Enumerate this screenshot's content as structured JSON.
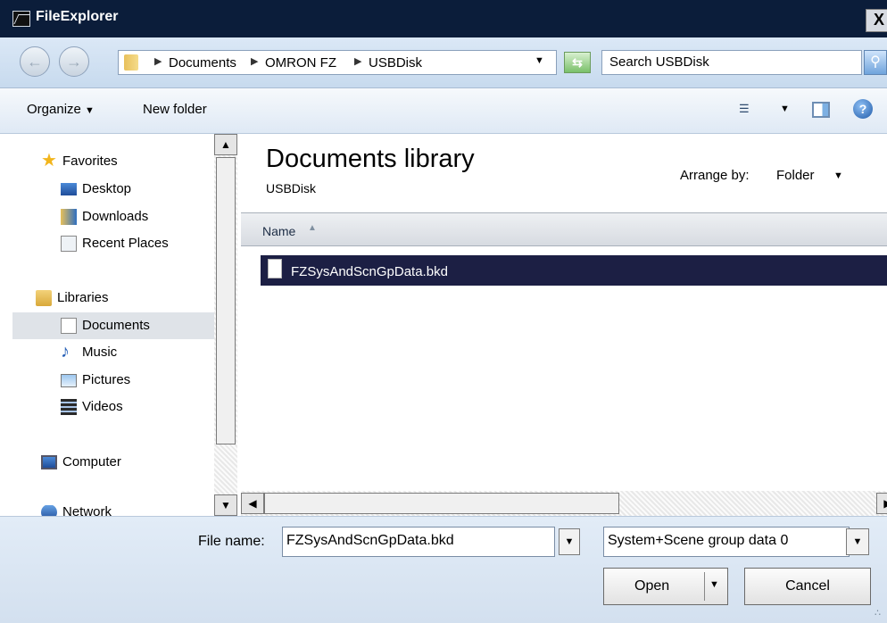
{
  "window": {
    "title": "FileExplorer",
    "close_label": "X"
  },
  "nav": {
    "back_icon": "back-arrow-icon",
    "forward_icon": "forward-arrow-icon",
    "breadcrumbs": [
      "Documents",
      "OMRON FZ",
      "USBDisk"
    ],
    "search_placeholder": "Search USBDisk"
  },
  "toolbar": {
    "organize_label": "Organize",
    "new_folder_label": "New folder"
  },
  "sidebar": {
    "favorites": {
      "label": "Favorites",
      "items": [
        "Desktop",
        "Downloads",
        "Recent Places"
      ]
    },
    "libraries": {
      "label": "Libraries",
      "items": [
        "Documents",
        "Music",
        "Pictures",
        "Videos"
      ]
    },
    "computer": {
      "label": "Computer"
    },
    "network": {
      "label": "Network"
    }
  },
  "main": {
    "library_title": "Documents library",
    "library_subtitle": "USBDisk",
    "arrange_label": "Arrange by:",
    "arrange_value": "Folder",
    "column_name": "Name",
    "files": [
      {
        "name": "FZSysAndScnGpData.bkd",
        "selected": true
      }
    ]
  },
  "footer": {
    "file_name_label": "File name:",
    "file_name_value": "FZSysAndScnGpData.bkd",
    "filter_value": "System+Scene group data 0",
    "open_label": "Open",
    "cancel_label": "Cancel"
  },
  "colors": {
    "titlebar": "#0b1d3a",
    "selection": "#1c1f44",
    "nav_selected": "#dfe3e8"
  }
}
